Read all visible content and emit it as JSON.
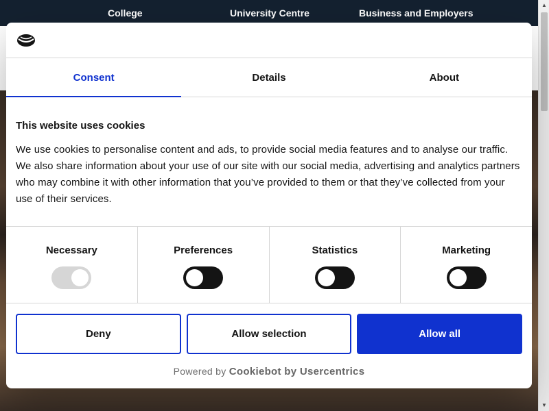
{
  "site_nav": {
    "items": [
      "College",
      "University Centre",
      "Business and Employers"
    ]
  },
  "dialog": {
    "logo_icon": "cookiebot-logo-icon",
    "tabs": [
      {
        "label": "Consent",
        "active": true
      },
      {
        "label": "Details",
        "active": false
      },
      {
        "label": "About",
        "active": false
      }
    ],
    "heading": "This website uses cookies",
    "body": "We use cookies to personalise content and ads, to provide social media features and to analyse our traffic. We also share information about your use of our site with our social media, advertising and analytics partners who may combine it with other information that you’ve provided to them or that they’ve collected from your use of their services.",
    "toggles": [
      {
        "label": "Necessary",
        "state": "on",
        "disabled": true
      },
      {
        "label": "Preferences",
        "state": "off",
        "disabled": false
      },
      {
        "label": "Statistics",
        "state": "off",
        "disabled": false
      },
      {
        "label": "Marketing",
        "state": "off",
        "disabled": false
      }
    ],
    "buttons": {
      "deny": "Deny",
      "allow_selection": "Allow selection",
      "allow_all": "Allow all"
    },
    "powered_by": {
      "prefix": "Powered by",
      "brand": "Cookiebot by Usercentrics"
    }
  },
  "colors": {
    "accent": "#1032cf",
    "text": "#141414",
    "nav_bg": "#142130"
  },
  "scrollbar": {
    "up_icon": "scroll-up-arrow-icon",
    "down_icon": "scroll-down-arrow-icon"
  }
}
